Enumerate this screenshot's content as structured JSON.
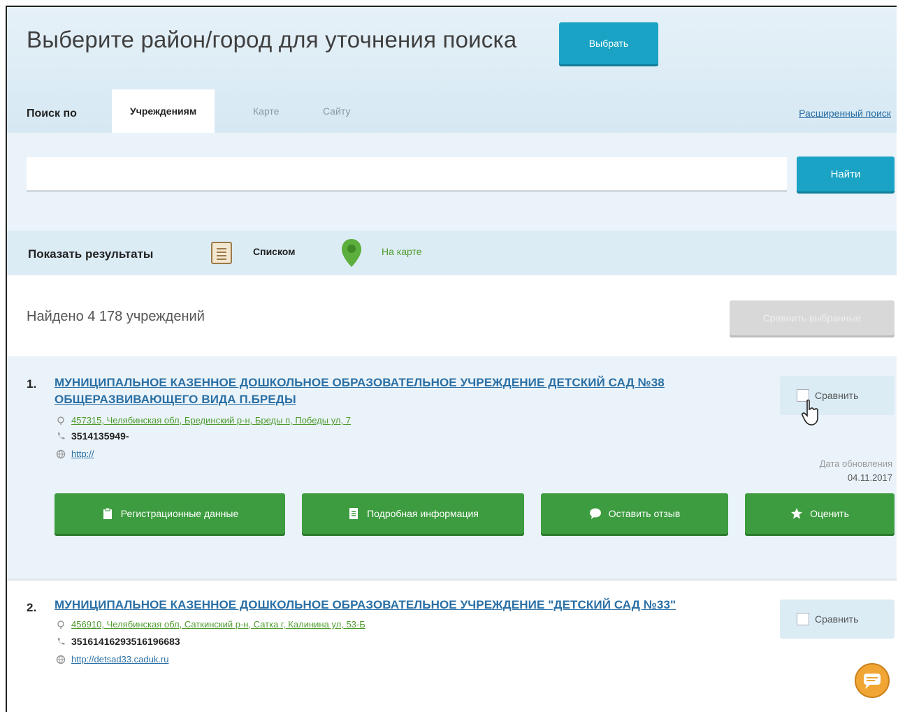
{
  "header": {
    "title": "Выберите район/город для уточнения поиска",
    "select_button": "Выбрать"
  },
  "tabs": {
    "label": "Поиск по",
    "items": [
      "Учреждениям",
      "Карте",
      "Сайту"
    ],
    "active": "Учреждениям",
    "advanced_link": "Расширенный поиск"
  },
  "search": {
    "value": "",
    "placeholder": "",
    "find_button": "Найти"
  },
  "view": {
    "label": "Показать результаты",
    "list_option": "Списком",
    "map_option": "На карте"
  },
  "results": {
    "count_text": "Найдено 4 178 учреждений",
    "favorites_button": "Сравнить выбранные",
    "items": [
      {
        "number": "1.",
        "title": "МУНИЦИПАЛЬНОЕ КАЗЕННОЕ ДОШКОЛЬНОЕ ОБРАЗОВАТЕЛЬНОЕ УЧРЕЖДЕНИЕ ДЕТСКИЙ САД №38 ОБЩЕРАЗВИВАЮЩЕГО ВИДА П.БРЕДЫ",
        "address": "457315, Челябинская обл, Брединский р-н, Бреды п, Победы ул, 7",
        "phone": "3514135949-",
        "site": "http://",
        "compare_label": "Сравнить",
        "update_label": "Дата обновления",
        "update_date": "04.11.2017"
      },
      {
        "number": "2.",
        "title": "МУНИЦИПАЛЬНОЕ КАЗЕННОЕ ДОШКОЛЬНОЕ ОБРАЗОВАТЕЛЬНОЕ УЧРЕЖДЕНИЕ \"ДЕТСКИЙ САД №33\"",
        "address": "456910, Челябинская обл, Саткинский р-н, Сатка г, Калинина ул, 53-Б",
        "phone": "35161416293516196683",
        "site": "http://detsad33.caduk.ru",
        "compare_label": "Сравнить"
      }
    ],
    "actions": {
      "registration": "Регистрационные данные",
      "details": "Подробная информация",
      "review": "Оставить отзыв",
      "rate": "Оценить"
    }
  },
  "colors": {
    "accent_blue": "#1aa3c4",
    "action_green": "#3c9c3f",
    "link_blue": "#2a6fa5",
    "address_green": "#4f9b2f"
  },
  "icons": [
    "list-icon",
    "map-pin-icon",
    "location-icon",
    "phone-icon",
    "globe-icon",
    "clipboard-icon",
    "document-icon",
    "chat-bubble-icon",
    "star-icon",
    "hand-cursor-icon",
    "chat-widget-icon"
  ]
}
